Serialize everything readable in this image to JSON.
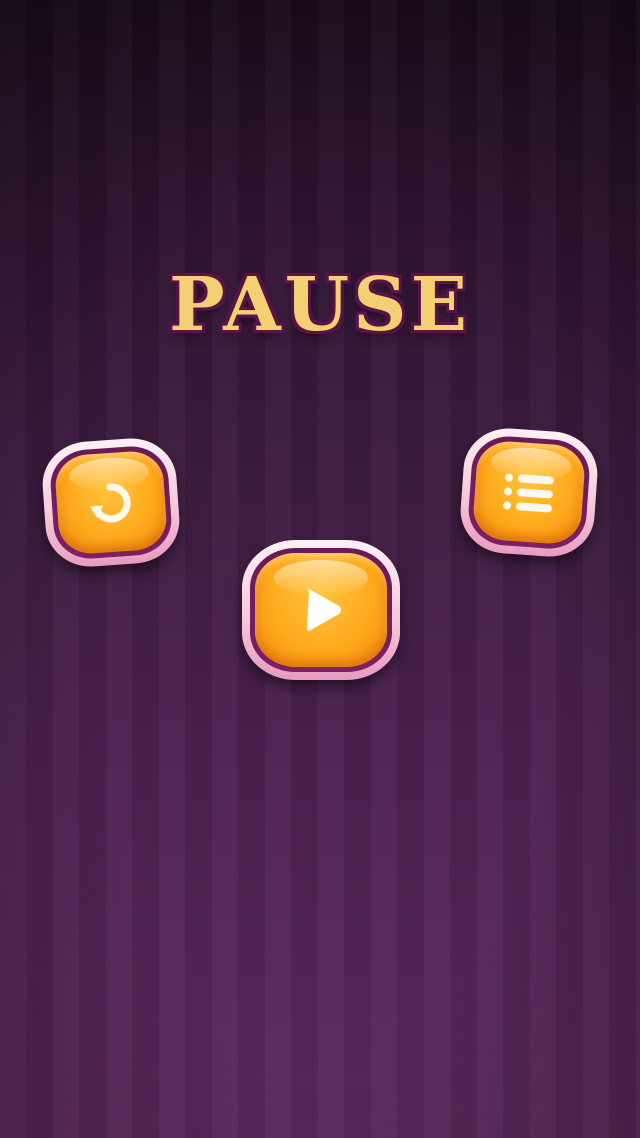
{
  "screen": {
    "title": "PAUSE"
  },
  "buttons": {
    "restart": {
      "icon": "restart-icon"
    },
    "play": {
      "icon": "play-icon"
    },
    "menu": {
      "icon": "menu-list-icon"
    }
  },
  "colors": {
    "title_fill": "#f3d072",
    "title_outline": "#5a1446",
    "button_face": "#ffaa1c",
    "button_rim": "#f7c9dc",
    "background_top": "#1c0c1c",
    "background_bottom": "#5c2a5e"
  }
}
